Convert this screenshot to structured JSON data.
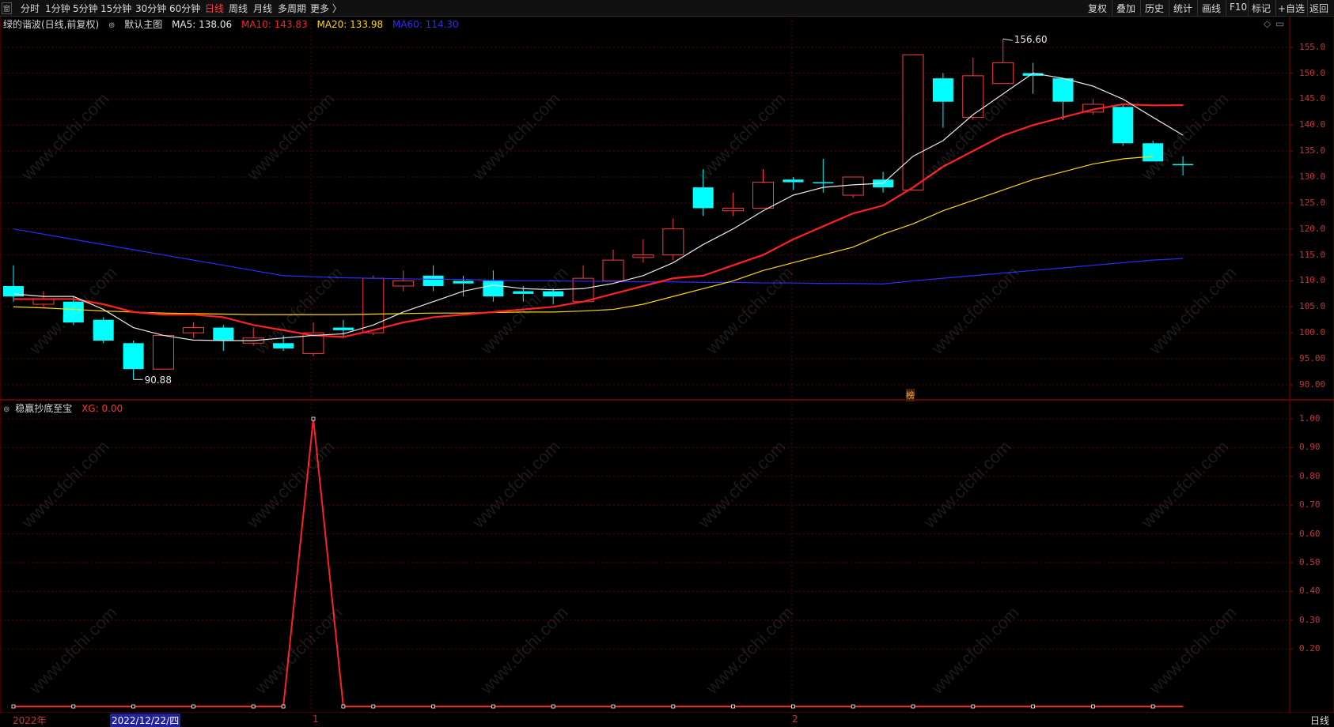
{
  "toolbar": {
    "left_icon": "窗",
    "periods": [
      "分时",
      "1分钟",
      "5分钟",
      "15分钟",
      "30分钟",
      "60分钟",
      "日线",
      "周线",
      "月线",
      "多周期",
      "更多 〉"
    ],
    "active_period": "日线",
    "right_buttons": [
      "复权",
      "叠加",
      "历史",
      "统计",
      "画线",
      "F10",
      "标记",
      "+自选",
      "返回"
    ]
  },
  "main_panel": {
    "stock_name": "绿的谐波(日线,前复权)",
    "chart_name": "默认主图",
    "ma5": {
      "label": "MA5: 138.06",
      "color": "#e8e8e8"
    },
    "ma10": {
      "label": "MA10: 143.83",
      "color": "#ff2020"
    },
    "ma20": {
      "label": "MA20: 133.98",
      "color": "#ffd700"
    },
    "ma60": {
      "label": "MA60: 114.30",
      "color": "#2b2bff"
    },
    "high_label": "156.60",
    "low_label": "90.88",
    "marker_label": "榜",
    "y_ticks": [
      "155.0",
      "150.0",
      "145.0",
      "140.0",
      "135.0",
      "130.0",
      "125.0",
      "120.0",
      "115.0",
      "110.0",
      "105.0",
      "100.0",
      "95.00",
      "90.00"
    ]
  },
  "indicator_panel": {
    "name": "稳赢抄底至宝",
    "xg_label": "XG: 0.00",
    "y_ticks": [
      "1.00",
      "0.90",
      "0.80",
      "0.70",
      "0.60",
      "0.50",
      "0.40",
      "0.30",
      "0.20"
    ]
  },
  "date_axis": {
    "year_label": "2022年",
    "selected_date": "2022/12/22/四",
    "month1": "1",
    "month2": "2",
    "period_label": "日线"
  },
  "watermark": "www.cfchi.com",
  "chart_data": {
    "type": "candlestick",
    "up_color": "#ff3b3b",
    "down_color": "#00ffff",
    "ylim": [
      88,
      158
    ],
    "candles": [
      {
        "o": 109,
        "c": 107,
        "h": 113,
        "l": 106
      },
      {
        "o": 105.5,
        "c": 106.5,
        "h": 108,
        "l": 105
      },
      {
        "o": 106,
        "c": 102,
        "h": 107,
        "l": 101.5
      },
      {
        "o": 102.5,
        "c": 98.5,
        "h": 103,
        "l": 98
      },
      {
        "o": 98,
        "c": 93,
        "h": 98.5,
        "l": 91
      },
      {
        "o": 93,
        "c": 99.5,
        "h": 99.5,
        "l": 93
      },
      {
        "o": 100,
        "c": 101,
        "h": 102,
        "l": 99
      },
      {
        "o": 101,
        "c": 98.5,
        "h": 101.5,
        "l": 96.5
      },
      {
        "o": 98,
        "c": 99,
        "h": 101,
        "l": 97.5
      },
      {
        "o": 98,
        "c": 97,
        "h": 99.5,
        "l": 96.5
      },
      {
        "o": 96,
        "c": 100,
        "h": 102,
        "l": 95.5
      },
      {
        "o": 101,
        "c": 100.5,
        "h": 102.5,
        "l": 99
      },
      {
        "o": 100,
        "c": 110.5,
        "h": 111,
        "l": 99.5
      },
      {
        "o": 109,
        "c": 110,
        "h": 112,
        "l": 108
      },
      {
        "o": 111,
        "c": 109,
        "h": 113,
        "l": 108
      },
      {
        "o": 110,
        "c": 109.5,
        "h": 111,
        "l": 107
      },
      {
        "o": 110,
        "c": 107,
        "h": 112,
        "l": 106
      },
      {
        "o": 108,
        "c": 107.5,
        "h": 109,
        "l": 106
      },
      {
        "o": 108,
        "c": 107,
        "h": 108.5,
        "l": 105.5
      },
      {
        "o": 106,
        "c": 110.5,
        "h": 113,
        "l": 106
      },
      {
        "o": 110,
        "c": 114,
        "h": 116,
        "l": 110
      },
      {
        "o": 114.5,
        "c": 115,
        "h": 118,
        "l": 113.5
      },
      {
        "o": 115,
        "c": 120,
        "h": 122,
        "l": 114
      },
      {
        "o": 128,
        "c": 124,
        "h": 131.5,
        "l": 122.5
      },
      {
        "o": 123.5,
        "c": 124,
        "h": 127,
        "l": 122.5
      },
      {
        "o": 124,
        "c": 129,
        "h": 131.5,
        "l": 124
      },
      {
        "o": 129.5,
        "c": 129,
        "h": 130,
        "l": 127.5
      },
      {
        "o": 129,
        "c": 128.8,
        "h": 133.5,
        "l": 127
      },
      {
        "o": 126.5,
        "c": 130,
        "h": 130,
        "l": 126
      },
      {
        "o": 129.5,
        "c": 128,
        "h": 131,
        "l": 127
      },
      {
        "o": 127.5,
        "c": 153.5,
        "h": 153.5,
        "l": 127.5
      },
      {
        "o": 149,
        "c": 144.5,
        "h": 150,
        "l": 139.5
      },
      {
        "o": 141.5,
        "c": 149.5,
        "h": 153,
        "l": 141
      },
      {
        "o": 148,
        "c": 152,
        "h": 156.6,
        "l": 148
      },
      {
        "o": 150,
        "c": 149.5,
        "h": 152,
        "l": 146
      },
      {
        "o": 149,
        "c": 144.5,
        "h": 149,
        "l": 141
      },
      {
        "o": 142.5,
        "c": 144,
        "h": 145,
        "l": 142
      },
      {
        "o": 143.5,
        "c": 136.5,
        "h": 144,
        "l": 136
      },
      {
        "o": 136.5,
        "c": 133,
        "h": 137,
        "l": 133
      },
      {
        "o": 132.5,
        "c": 132.3,
        "h": 134,
        "l": 130.3
      }
    ],
    "ma5": [
      107.5,
      107,
      107,
      104.5,
      101,
      99.5,
      98.6,
      98.5,
      98.5,
      99,
      99.5,
      99.8,
      101.5,
      104,
      106,
      108,
      109.2,
      108.5,
      108.3,
      108.5,
      109.5,
      111,
      113.5,
      117,
      120,
      123.5,
      126.5,
      128,
      128.5,
      128.8,
      134,
      137,
      142,
      146,
      150,
      149,
      147.5,
      145,
      141.5,
      138.06
    ],
    "ma10": [
      106.5,
      106.5,
      106.5,
      105.5,
      104,
      103.5,
      103.5,
      103,
      101.5,
      100.5,
      99.5,
      99.2,
      100.5,
      102,
      103,
      103.5,
      104,
      104.5,
      105,
      106,
      107.5,
      109,
      110.5,
      111,
      113,
      115,
      118,
      120.5,
      123,
      124.5,
      128,
      132,
      135,
      138,
      140,
      141.5,
      143,
      144,
      143.8,
      143.83
    ],
    "ma20": [
      105,
      104.8,
      104.5,
      104.2,
      104,
      103.8,
      103.7,
      103.6,
      103.5,
      103.5,
      103.5,
      103.5,
      103.6,
      103.7,
      103.8,
      103.8,
      103.9,
      104,
      104,
      104.2,
      104.5,
      105.5,
      107,
      108.5,
      110,
      112,
      113.5,
      115,
      116.5,
      119,
      121,
      123.5,
      125.5,
      127.5,
      129.5,
      131,
      132.5,
      133.5,
      133.98
    ],
    "ma60": [
      120,
      119,
      118,
      117,
      116,
      115,
      114,
      113,
      112,
      111,
      110.8,
      110.6,
      110.5,
      110.4,
      110.3,
      110.3,
      110.1,
      110,
      110,
      109.9,
      109.9,
      109.8,
      109.8,
      109.7,
      109.7,
      109.6,
      109.6,
      109.5,
      109.5,
      109.4,
      110,
      110.5,
      111,
      111.5,
      112,
      112.5,
      113,
      113.5,
      114,
      114.3
    ],
    "xg": [
      0,
      0,
      0,
      0,
      0,
      0,
      0,
      0,
      0,
      0,
      1,
      0,
      0,
      0,
      0,
      0,
      0,
      0,
      0,
      0,
      0,
      0,
      0,
      0,
      0,
      0,
      0,
      0,
      0,
      0,
      0,
      0,
      0,
      0,
      0,
      0,
      0,
      0,
      0,
      0
    ]
  }
}
